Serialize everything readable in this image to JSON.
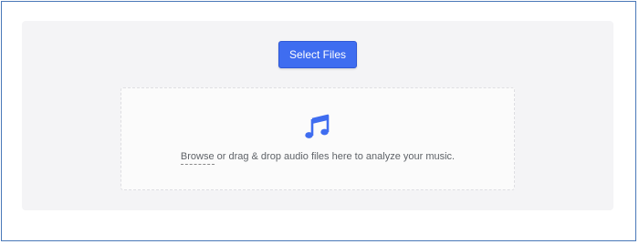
{
  "uploader": {
    "select_button_label": "Select Files",
    "browse_link": "Browse",
    "drop_text": " or drag & drop audio files here to analyze your music."
  },
  "icons": {
    "drop_zone_icon": "music-note-icon"
  },
  "colors": {
    "accent": "#3f6df0",
    "panel_background": "#f4f4f6",
    "frame_border": "#4a78b8"
  }
}
